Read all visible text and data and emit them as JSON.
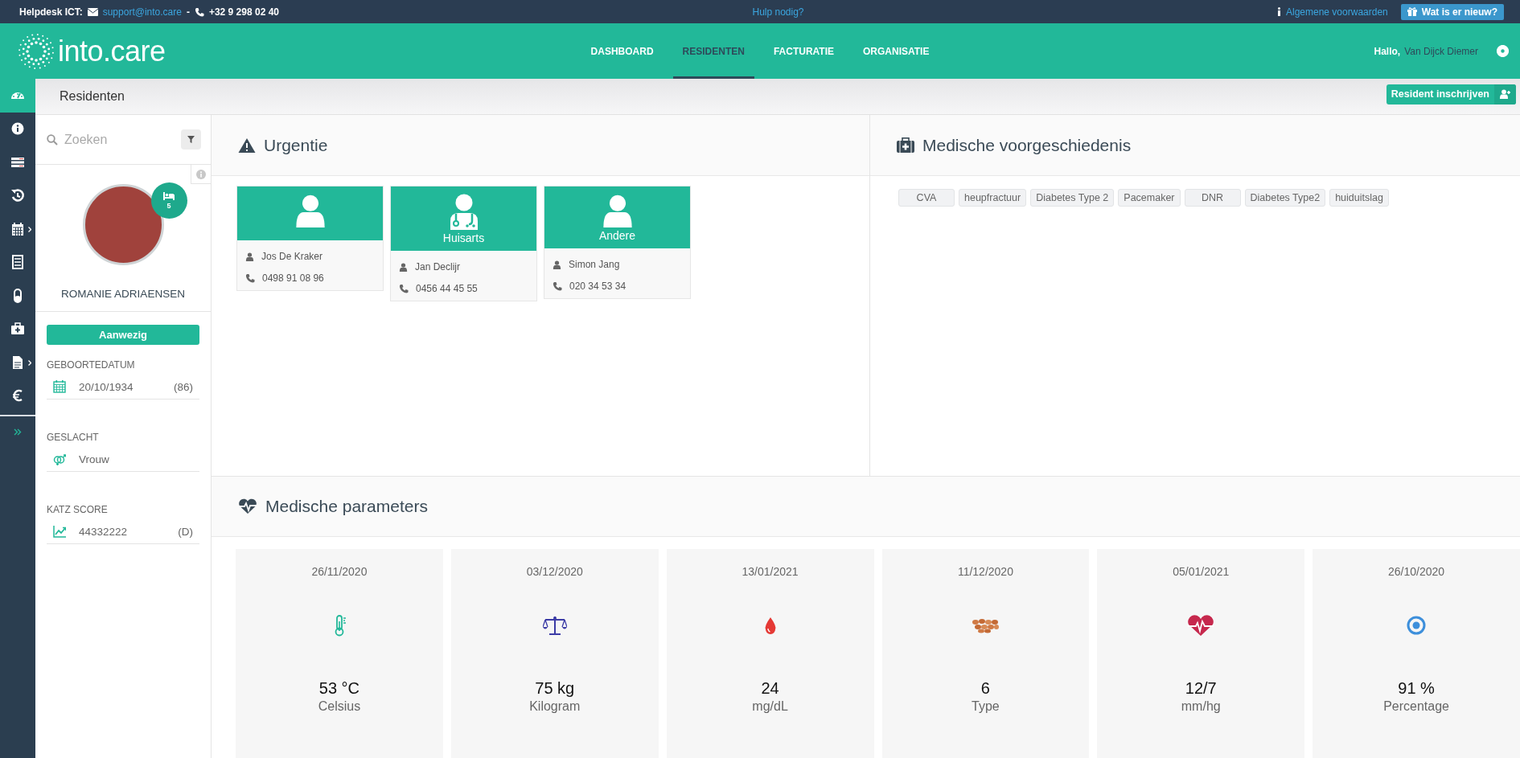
{
  "topbar": {
    "helpdesk_label": "Helpdesk ICT:",
    "email": "support@into.care",
    "separator": "-",
    "phone": "+32 9 298 02 40",
    "help_link": "Hulp nodig?",
    "terms_link": "Algemene voorwaarden",
    "whats_new_button": "Wat is er nieuw?"
  },
  "header": {
    "logo_text": "into.care",
    "nav": [
      {
        "label": "DASHBOARD",
        "selected": false
      },
      {
        "label": "RESIDENTEN",
        "selected": true
      },
      {
        "label": "FACTURATIE",
        "selected": false
      },
      {
        "label": "ORGANISATIE",
        "selected": false
      }
    ],
    "greeting": "Hallo,",
    "user_name": "Van Dijck Diemer"
  },
  "sidebar": {
    "items": [
      {
        "kind": "dashboard",
        "selected": true,
        "submenu": false
      },
      {
        "kind": "info",
        "selected": false,
        "submenu": false
      },
      {
        "kind": "cards",
        "selected": false,
        "submenu": false
      },
      {
        "kind": "history",
        "selected": false,
        "submenu": false
      },
      {
        "kind": "calendar",
        "selected": false,
        "submenu": true
      },
      {
        "kind": "checklist",
        "selected": false,
        "submenu": false
      },
      {
        "kind": "pill",
        "selected": false,
        "submenu": false
      },
      {
        "kind": "medkit",
        "selected": false,
        "submenu": false
      },
      {
        "kind": "document",
        "selected": false,
        "submenu": true
      },
      {
        "kind": "euro",
        "selected": false,
        "submenu": false
      }
    ]
  },
  "page": {
    "title": "Residenten",
    "add_button": "Resident inschrijven"
  },
  "resident": {
    "search": {
      "placeholder": "Zoeken"
    },
    "room": "5",
    "name": "ROMANIE ADRIAENSEN",
    "status": "Aanwezig",
    "fields": [
      {
        "kind": "birthdate",
        "label": "GEBOORTEDATUM",
        "value": "20/10/1934",
        "extra": "(86)"
      },
      {
        "kind": "gender",
        "label": "GESLACHT",
        "value": "Vrouw"
      },
      {
        "kind": "katz",
        "label": "KATZ SCORE",
        "value": "44332222",
        "extra": "(D)"
      }
    ]
  },
  "urgentie": {
    "title": "Urgentie",
    "contacts": [
      {
        "kind": "person",
        "name": "Jos De Kraker",
        "phone": "0498 91 08 96"
      },
      {
        "kind": "doctor",
        "role": "Huisarts",
        "name": "Jan Declijr",
        "phone": "0456 44 45 55"
      },
      {
        "kind": "person",
        "role": "Andere",
        "name": "Simon Jang",
        "phone": "020 34 53 34"
      }
    ]
  },
  "history": {
    "title": "Medische voorgeschiedenis",
    "tags": [
      "CVA",
      "heupfractuur",
      "Diabetes Type 2",
      "Pacemaker",
      "DNR",
      "Diabetes Type2",
      "huiduitslag"
    ]
  },
  "parameters": {
    "title": "Medische parameters",
    "items": [
      {
        "kind": "temperature",
        "date": "26/11/2020",
        "value": "53 °C",
        "unit": "Celsius"
      },
      {
        "kind": "weight",
        "date": "03/12/2020",
        "value": "75 kg",
        "unit": "Kilogram"
      },
      {
        "kind": "glucose",
        "date": "13/01/2021",
        "value": "24",
        "unit": "mg/dL"
      },
      {
        "kind": "stool",
        "date": "11/12/2020",
        "value": "6",
        "unit": "Type"
      },
      {
        "kind": "pressure",
        "date": "05/01/2021",
        "value": "12/7",
        "unit": "mm/hg"
      },
      {
        "kind": "saturation",
        "date": "26/10/2020",
        "value": "91 %",
        "unit": "Percentage"
      }
    ]
  }
}
